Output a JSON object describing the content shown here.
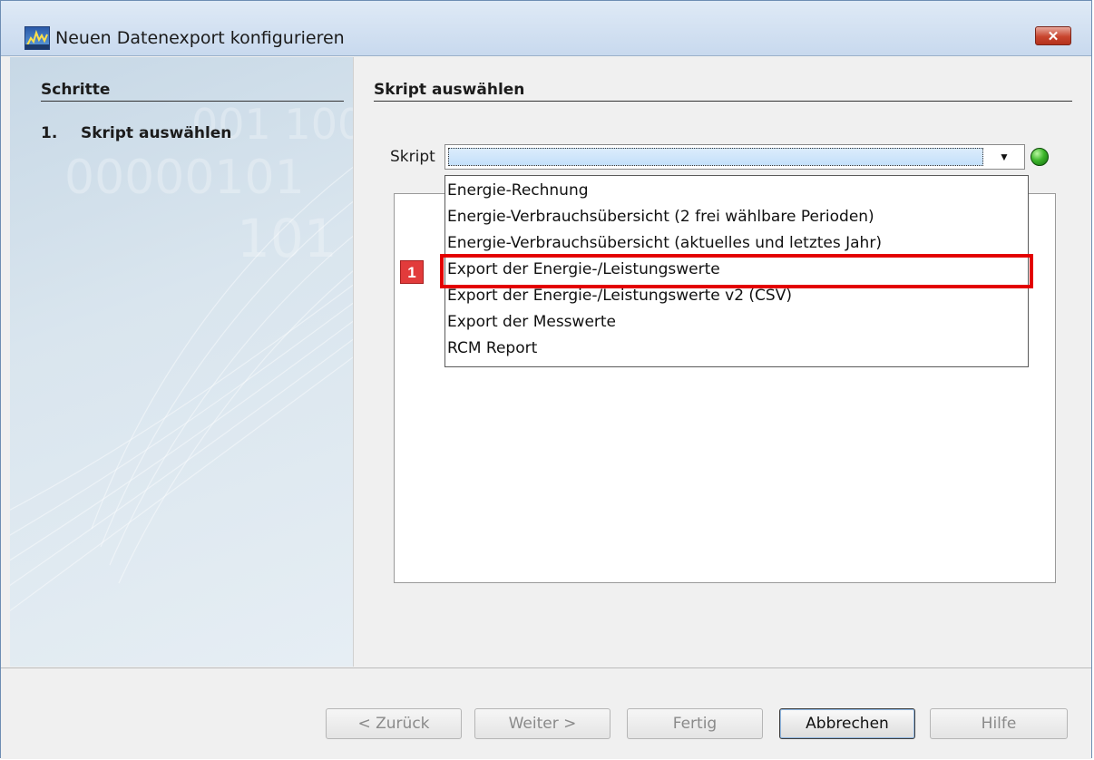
{
  "window": {
    "title": "Neuen Datenexport konfigurieren",
    "close_label": "✕"
  },
  "sidebar": {
    "heading": "Schritte",
    "steps": [
      {
        "number": "1.",
        "label": "Skript auswählen"
      }
    ]
  },
  "content": {
    "heading": "Skript auswählen",
    "script_label": "Skript",
    "combo_value": "",
    "status_color": "#3cb52a",
    "dropdown_items": [
      "Energie-Rechnung",
      "Energie-Verbrauchsübersicht (2 frei wählbare Perioden)",
      "Energie-Verbrauchsübersicht (aktuelles und letztes Jahr)",
      "Export der Energie-/Leistungswerte",
      "Export der Energie-/Leistungswerte v2 (CSV)",
      "Export der Messwerte",
      "RCM Report"
    ],
    "highlighted_index": 3
  },
  "callout": {
    "badge": "1",
    "color": "#e30000"
  },
  "footer": {
    "back_label": "< Zurück",
    "next_label": "Weiter >",
    "finish_label": "Fertig",
    "cancel_label": "Abbrechen",
    "help_label": "Hilfe"
  }
}
